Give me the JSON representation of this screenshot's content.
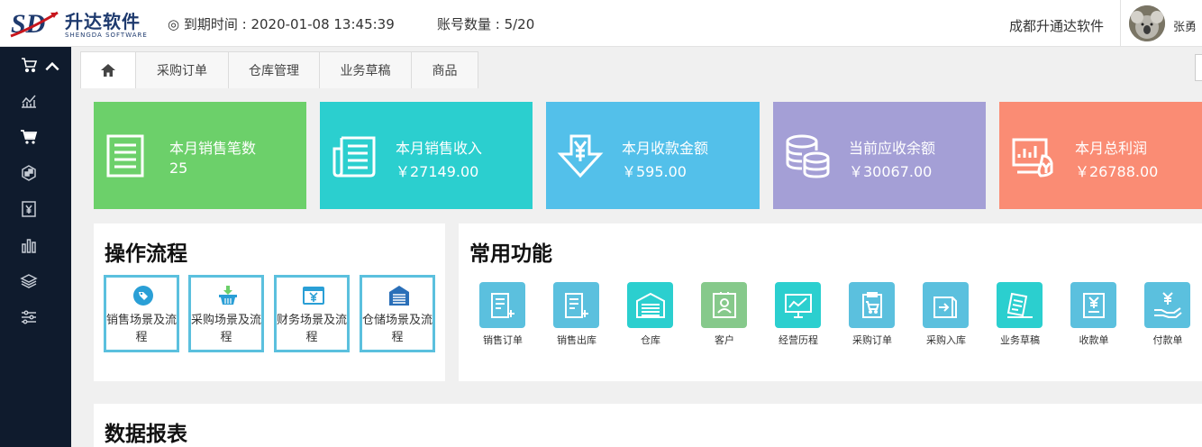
{
  "header": {
    "logo_name": "升达软件",
    "logo_sub": "SHENGDA SOFTWARE",
    "expiry": "◎ 到期时间 : 2020-01-08 13:45:39",
    "accounts": "账号数量 : 5/20",
    "company": "成都升通达软件",
    "username": "张勇"
  },
  "sidebar": {
    "items": [
      {
        "icon": "cart-list-icon"
      },
      {
        "icon": "chart-line-icon"
      },
      {
        "icon": "cart-icon"
      },
      {
        "icon": "boxes-icon"
      },
      {
        "icon": "yen-doc-icon"
      },
      {
        "icon": "bar-chart-icon"
      },
      {
        "icon": "layers-icon"
      },
      {
        "icon": "sliders-icon"
      }
    ]
  },
  "tabs": [
    {
      "label": "",
      "icon": "home-icon"
    },
    {
      "label": "采购订单"
    },
    {
      "label": "仓库管理"
    },
    {
      "label": "业务草稿"
    },
    {
      "label": "商品"
    }
  ],
  "stats": [
    {
      "label": "本月销售笔数",
      "value": "25",
      "color": "#6cd06a",
      "icon": "list-doc-icon"
    },
    {
      "label": "本月销售收入",
      "value": "￥27149.00",
      "color": "#2bcfcf",
      "icon": "newspaper-icon"
    },
    {
      "label": "本月收款金额",
      "value": "￥595.00",
      "color": "#53c0ea",
      "icon": "yen-down-icon"
    },
    {
      "label": "当前应收余额",
      "value": "￥30067.00",
      "color": "#a49fd6",
      "icon": "coins-icon"
    },
    {
      "label": "本月总利润",
      "value": "￥26788.00",
      "color": "#fa8c74",
      "icon": "profit-chart-icon"
    }
  ],
  "flow": {
    "title": "操作流程",
    "items": [
      {
        "label": "销售场景及流程",
        "icon": "tag-icon"
      },
      {
        "label": "采购场景及流程",
        "icon": "basket-icon"
      },
      {
        "label": "财务场景及流程",
        "icon": "yen-card-icon"
      },
      {
        "label": "仓储场景及流程",
        "icon": "warehouse-icon"
      }
    ]
  },
  "functions": {
    "title": "常用功能",
    "items": [
      {
        "label": "销售订单",
        "color": "#5bc0de",
        "icon": "doc-plus-icon"
      },
      {
        "label": "销售出库",
        "color": "#5bc0de",
        "icon": "doc-plus-icon"
      },
      {
        "label": "仓库",
        "color": "#2bcfcf",
        "icon": "warehouse-icon"
      },
      {
        "label": "客户",
        "color": "#86c98b",
        "icon": "contact-card-icon"
      },
      {
        "label": "经营历程",
        "color": "#2bcfcf",
        "icon": "monitor-chart-icon"
      },
      {
        "label": "采购订单",
        "color": "#5bc0de",
        "icon": "cart-clipboard-icon"
      },
      {
        "label": "采购入库",
        "color": "#5bc0de",
        "icon": "box-in-icon"
      },
      {
        "label": "业务草稿",
        "color": "#2bcfcf",
        "icon": "draft-icon"
      },
      {
        "label": "收款单",
        "color": "#5bc0de",
        "icon": "yen-receipt-icon"
      },
      {
        "label": "付款单",
        "color": "#5bc0de",
        "icon": "yen-hand-icon"
      }
    ]
  },
  "reports": {
    "title": "数据报表"
  }
}
